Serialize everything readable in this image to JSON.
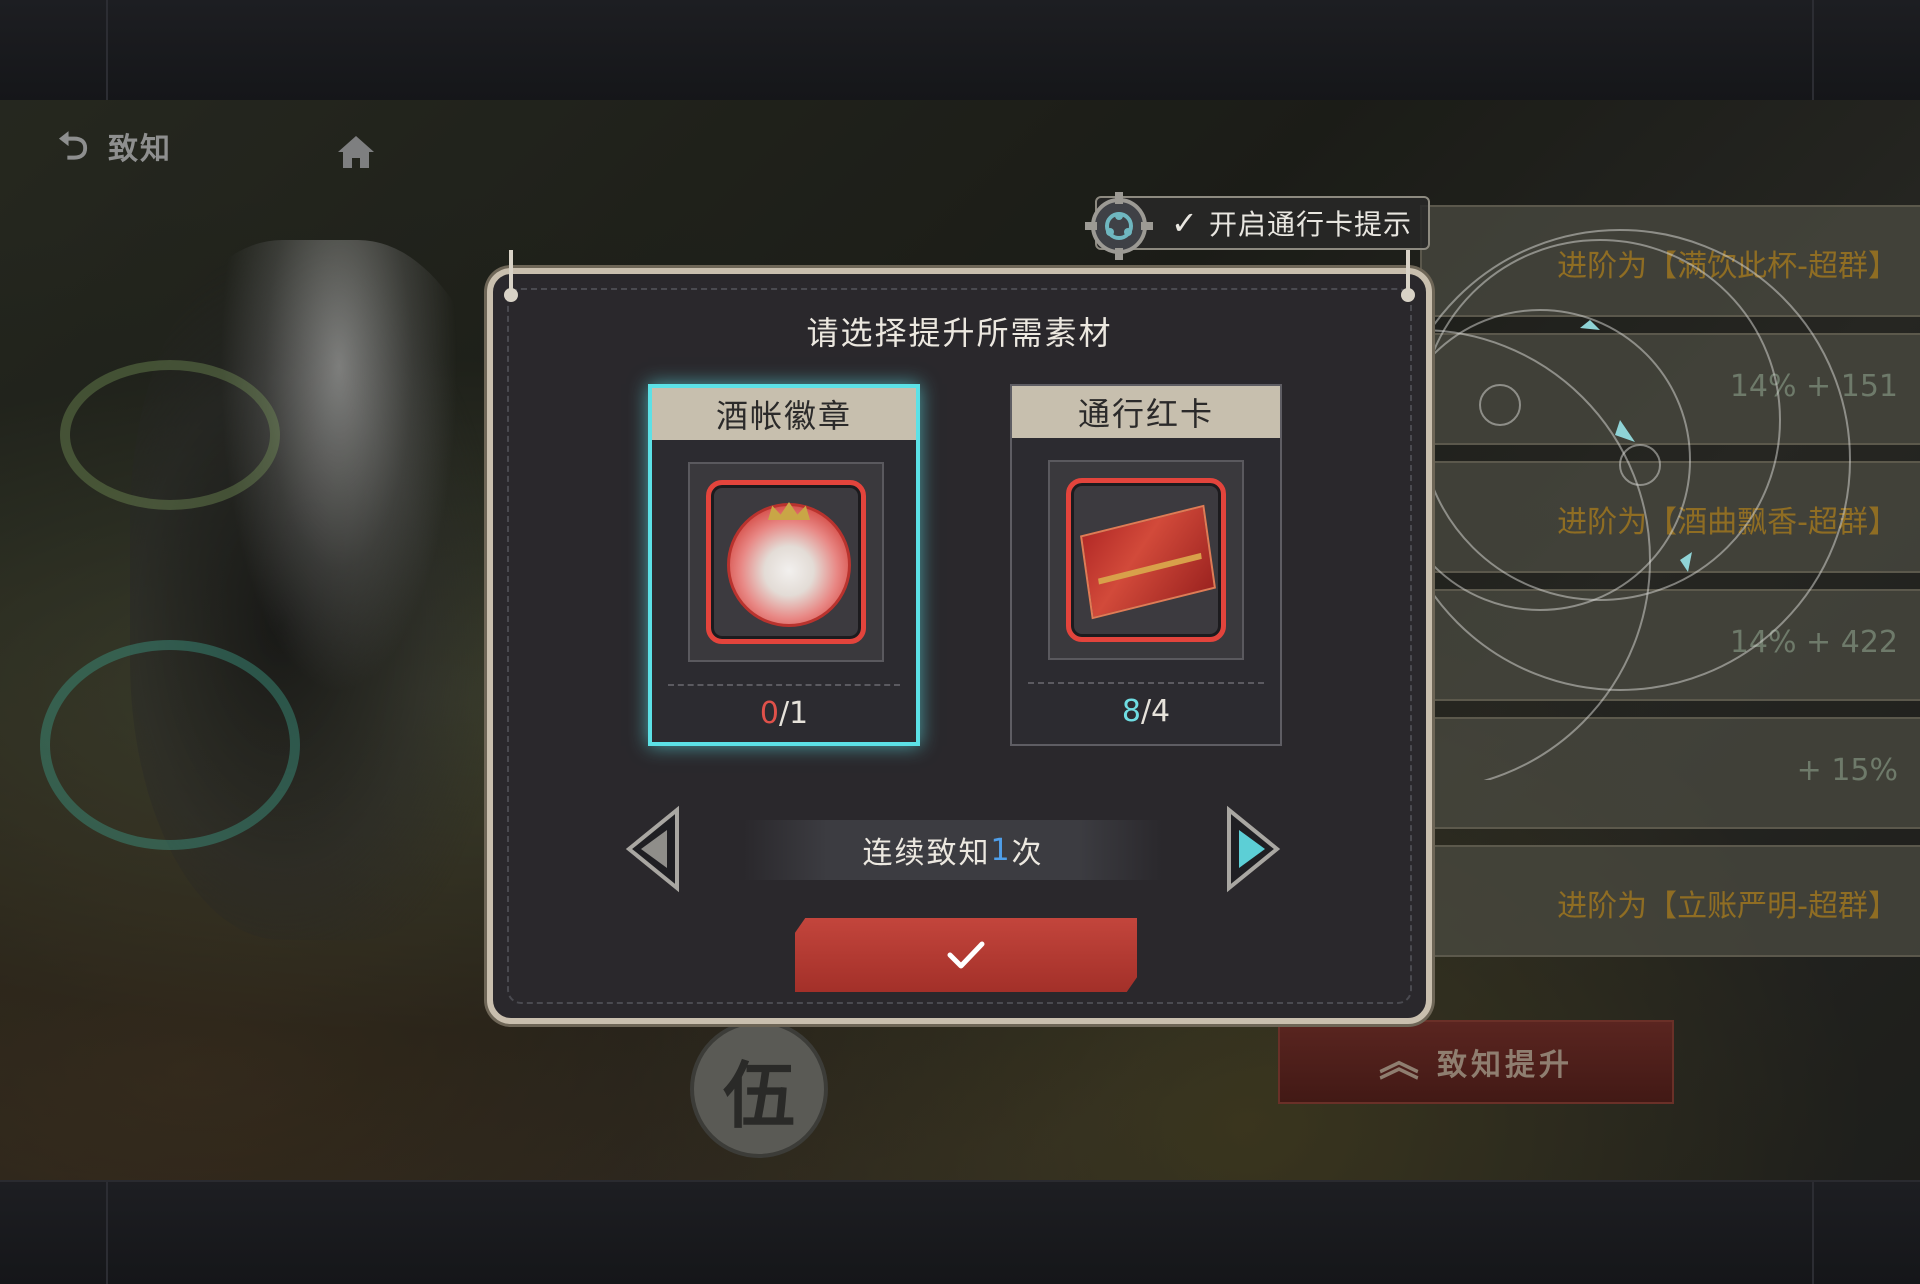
{
  "header": {
    "back_label": "致知"
  },
  "pass_toggle": {
    "label": "开启通行卡提示",
    "checked": true
  },
  "background_panel": {
    "rows": [
      {
        "text": "【满饮此杯】进阶为【满饮此杯-超群】",
        "visible_text": "进阶为【满饮此杯-超群】"
      },
      {
        "text": "14% + 151"
      },
      {
        "text": "进阶为【酒曲飘香-超群】"
      },
      {
        "text": "14% + 422"
      },
      {
        "text": "+ 15%"
      },
      {
        "text": "进阶为【立账严明-超群】"
      }
    ],
    "levelup_button": "致知提升",
    "seal_glyph": "伍"
  },
  "modal": {
    "title": "请选择提升所需素材",
    "materials": [
      {
        "name": "酒帐徽章",
        "have": "0",
        "need": "1",
        "selected": true,
        "icon": "badge-icon"
      },
      {
        "name": "通行红卡",
        "have": "8",
        "need": "4",
        "selected": false,
        "icon": "red-ticket-icon"
      }
    ],
    "repeat": {
      "prefix": "连续致知",
      "count": "1",
      "suffix": "次"
    }
  },
  "colors": {
    "accent_cyan": "#5ce1e6",
    "confirm_red": "#b43a32",
    "count_red": "#e0514a",
    "count_blue": "#4f9ee8"
  }
}
